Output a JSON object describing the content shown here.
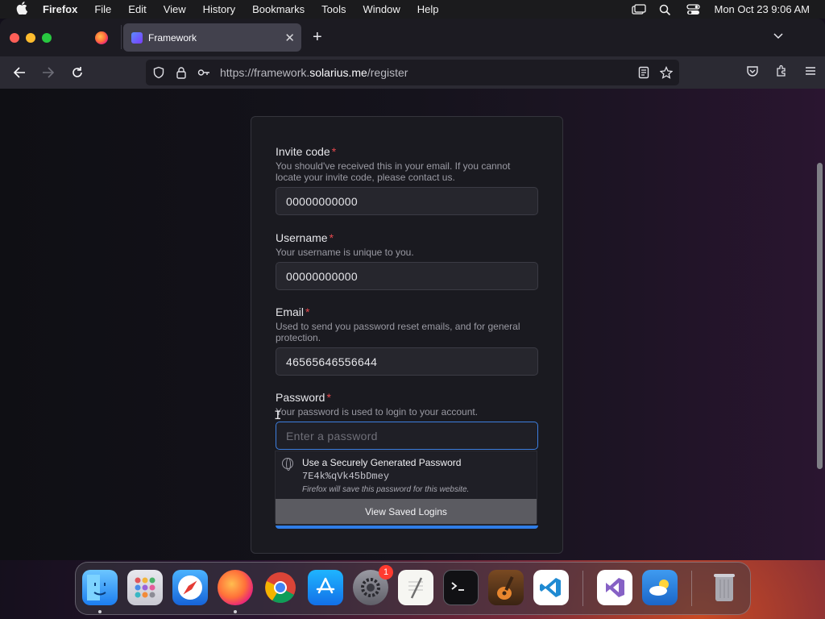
{
  "menubar": {
    "apple_icon": "apple-icon",
    "app_name": "Firefox",
    "items": [
      "File",
      "Edit",
      "View",
      "History",
      "Bookmarks",
      "Tools",
      "Window",
      "Help"
    ],
    "clock": "Mon Oct 23  9:06 AM",
    "status_icons": [
      "screen-mirroring-icon",
      "spotlight-search-icon",
      "control-center-icon"
    ]
  },
  "browser": {
    "tab_title": "Framework",
    "url": {
      "prefix": "https://framework.",
      "domain": "solarius.me",
      "path": "/register"
    }
  },
  "form": {
    "invite": {
      "label": "Invite code",
      "required_mark": "*",
      "help": "You should've received this in your email. If you cannot locate your invite code, please contact us.",
      "value": "00000000000"
    },
    "username": {
      "label": "Username",
      "required_mark": "*",
      "help": "Your username is unique to you.",
      "value": "00000000000"
    },
    "email": {
      "label": "Email",
      "required_mark": "*",
      "help": "Used to send you password reset emails, and for general protection.",
      "value": "46565646556644"
    },
    "password": {
      "label": "Password",
      "required_mark": "*",
      "help": "Your password is used to login to your account.",
      "placeholder": "Enter a password",
      "value": ""
    }
  },
  "autocomplete": {
    "title": "Use a Securely Generated Password",
    "generated_password": "7E4k%qVk45bDmey",
    "note": "Firefox will save this password for this website.",
    "footer": "View Saved Logins"
  },
  "dock": {
    "apps": [
      "Finder",
      "Launchpad",
      "Safari",
      "Firefox",
      "Chrome",
      "App Store",
      "System Settings",
      "TextEdit",
      "Terminal",
      "GarageBand",
      "Visual Studio Code",
      "Visual Studio",
      "Weather",
      "Trash"
    ],
    "system_settings_badge": "1"
  }
}
